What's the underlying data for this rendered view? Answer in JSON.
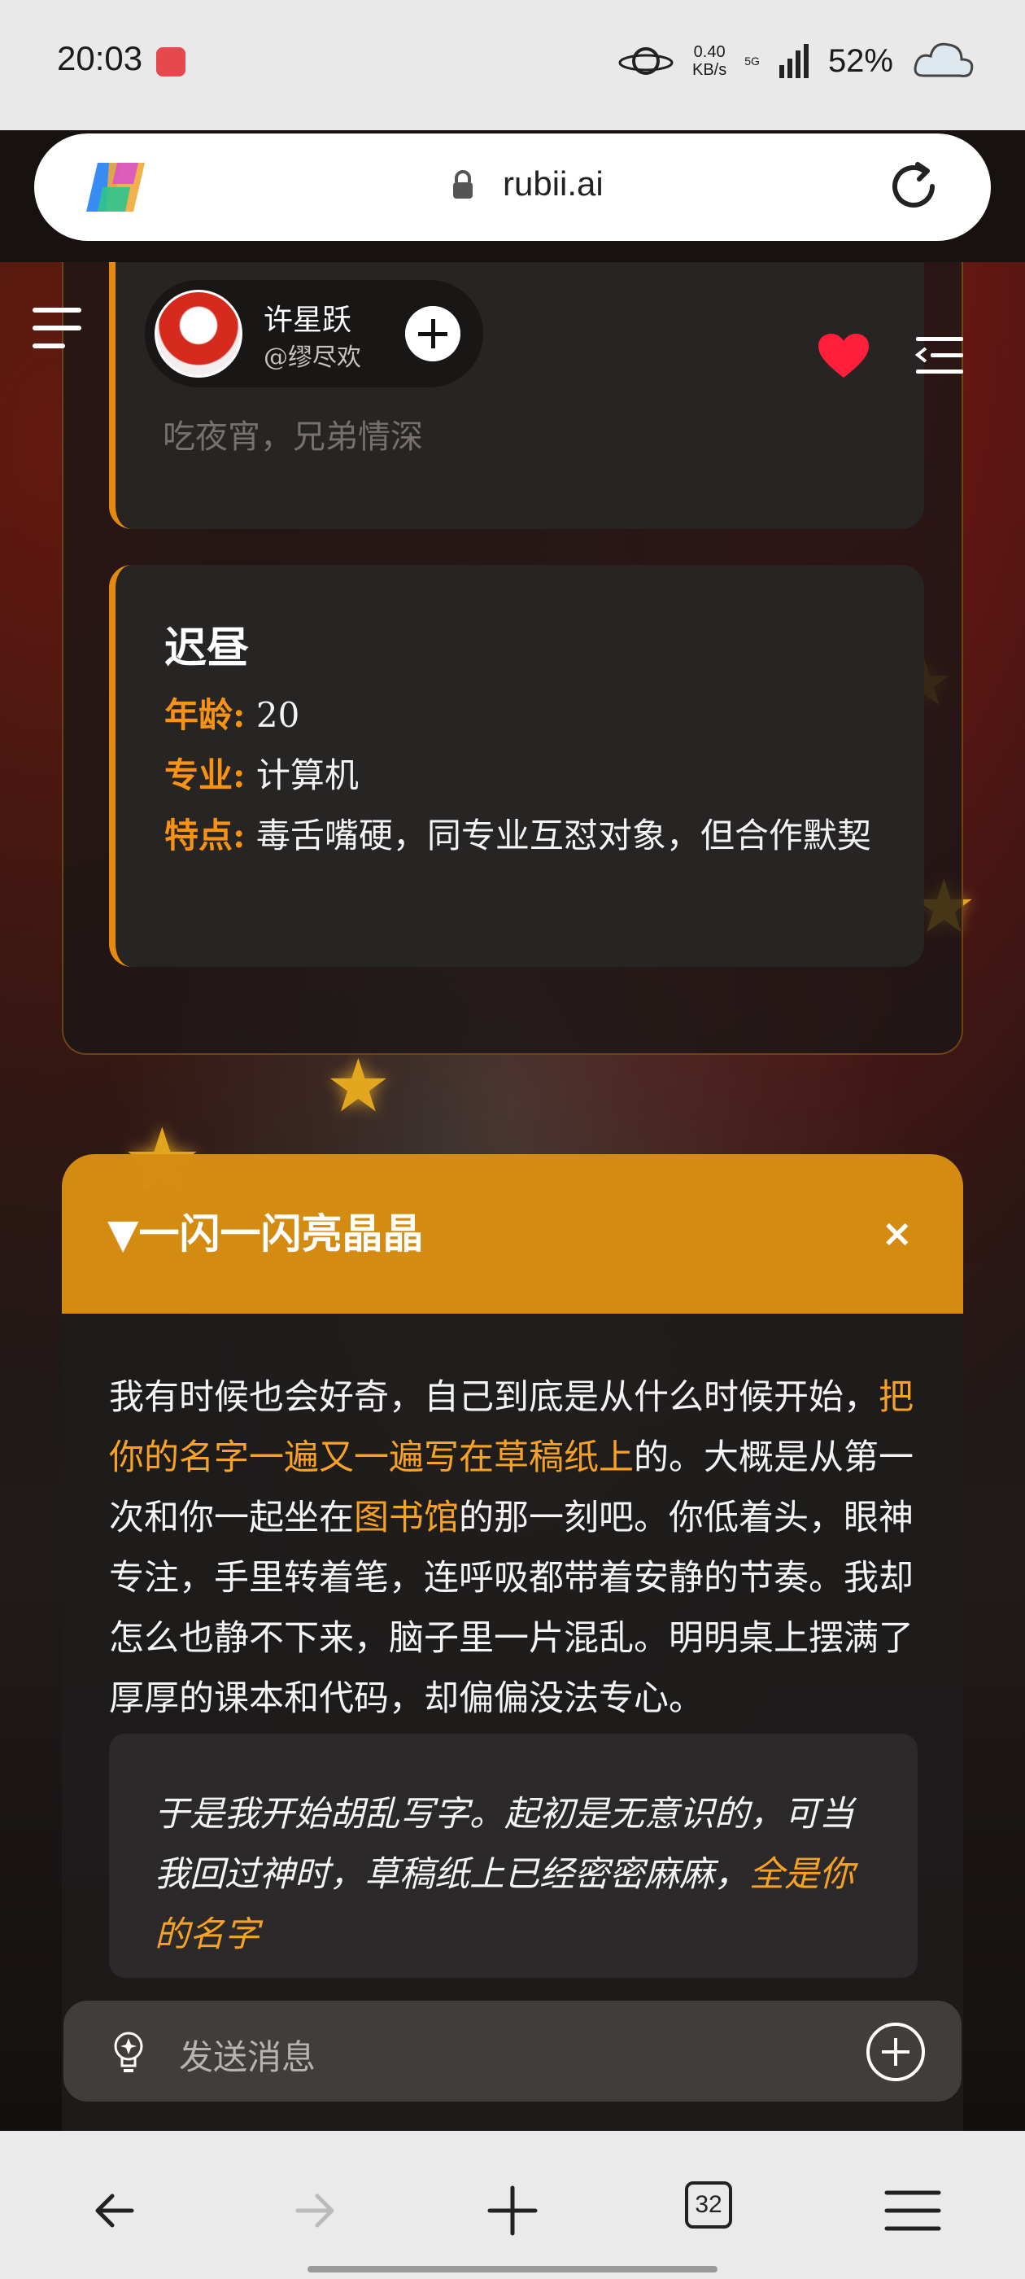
{
  "status_bar": {
    "time": "20:03",
    "net_speed": "0.40",
    "net_unit": "KB/s",
    "network_type": "5G",
    "battery": "52%"
  },
  "browser": {
    "url": "rubii.ai",
    "tab_count": "32"
  },
  "header": {
    "profile_name": "许星跃",
    "profile_handle": "@缪尽欢"
  },
  "character_list": {
    "previous_card_tail": "吃夜宵，兄弟情深",
    "card": {
      "name": "迟昼",
      "rows": [
        {
          "key": "年龄:",
          "value": " 20"
        },
        {
          "key": "专业:",
          "value": " 计算机"
        },
        {
          "key": "特点:",
          "value": " 毒舌嘴硬，同专业互怼对象，但合作默契"
        }
      ]
    }
  },
  "panel": {
    "title": "▼一闪一闪亮晶晶",
    "close": "×",
    "story": {
      "p1": "我有时候也会好奇，自己到底是从什么时候开始，",
      "hl1": "把你的名字一遍又一遍写在草稿纸上",
      "p2": "的。大概是从第一次和你一起坐在",
      "hl2": "图书馆",
      "p3": "的那一刻吧。你低着头，眼神专注，手里转着笔，连呼吸都带着安静的节奏。我却怎么也静不下来，脑子里一片混乱。明明桌上摆满了厚厚的课本和代码，却偏偏没法专心。"
    },
    "quote": {
      "text": "于是我开始胡乱写字。起初是无意识的，可当我回过神时，草稿纸上已经密密麻麻，",
      "hl": "全是你的名字"
    }
  },
  "composer": {
    "placeholder": "发送消息"
  },
  "colors": {
    "accent": "#f79215",
    "panel_header": "#e89812",
    "heart": "#ff1f3a"
  }
}
